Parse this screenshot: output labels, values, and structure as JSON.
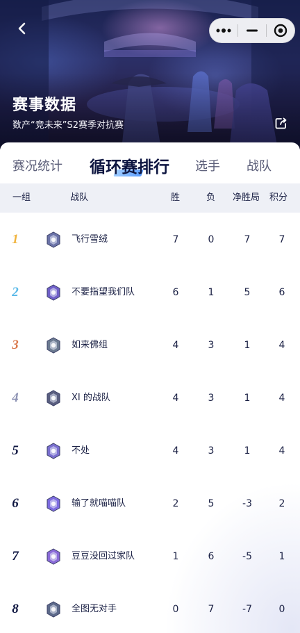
{
  "header": {
    "title": "赛事数据",
    "subtitle": "数产“竞未来”S2赛季对抗赛"
  },
  "tabs": [
    {
      "label": "赛况统计",
      "active": false
    },
    {
      "label": "循环赛排行",
      "active": true
    },
    {
      "label": "选手",
      "active": false
    },
    {
      "label": "战队",
      "active": false
    }
  ],
  "table": {
    "group_label": "一组",
    "columns": {
      "team": "战队",
      "wins": "胜",
      "losses": "负",
      "net": "净胜局",
      "points": "积分"
    },
    "rows": [
      {
        "rank": "1",
        "team": "飞行雪绒",
        "wins": "7",
        "losses": "0",
        "net": "7",
        "points": "7",
        "rank_color": "#f0b33c",
        "emblem_color": "#6b73a8"
      },
      {
        "rank": "2",
        "team": "不要指望我们队",
        "wins": "6",
        "losses": "1",
        "net": "5",
        "points": "6",
        "rank_color": "#57b8e8",
        "emblem_color": "#6f5fc8"
      },
      {
        "rank": "3",
        "team": "如来佛组",
        "wins": "4",
        "losses": "3",
        "net": "1",
        "points": "4",
        "rank_color": "#d9774a",
        "emblem_color": "#6b7a90"
      },
      {
        "rank": "4",
        "team": "XI 的战队",
        "wins": "4",
        "losses": "3",
        "net": "1",
        "points": "4",
        "rank_color": "#8e93b4",
        "emblem_color": "#5a5f80"
      },
      {
        "rank": "5",
        "team": "不处",
        "wins": "4",
        "losses": "3",
        "net": "1",
        "points": "4",
        "rank_color": "#0d1540",
        "emblem_color": "#7a6fcf"
      },
      {
        "rank": "6",
        "team": "输了就喵喵队",
        "wins": "2",
        "losses": "5",
        "net": "-3",
        "points": "2",
        "rank_color": "#0d1540",
        "emblem_color": "#7d6be0"
      },
      {
        "rank": "7",
        "team": "豆豆没回过家队",
        "wins": "1",
        "losses": "6",
        "net": "-5",
        "points": "1",
        "rank_color": "#0d1540",
        "emblem_color": "#8a6ad8"
      },
      {
        "rank": "8",
        "team": "全图无对手",
        "wins": "0",
        "losses": "7",
        "net": "-7",
        "points": "0",
        "rank_color": "#0d1540",
        "emblem_color": "#5d6a8a"
      }
    ]
  }
}
